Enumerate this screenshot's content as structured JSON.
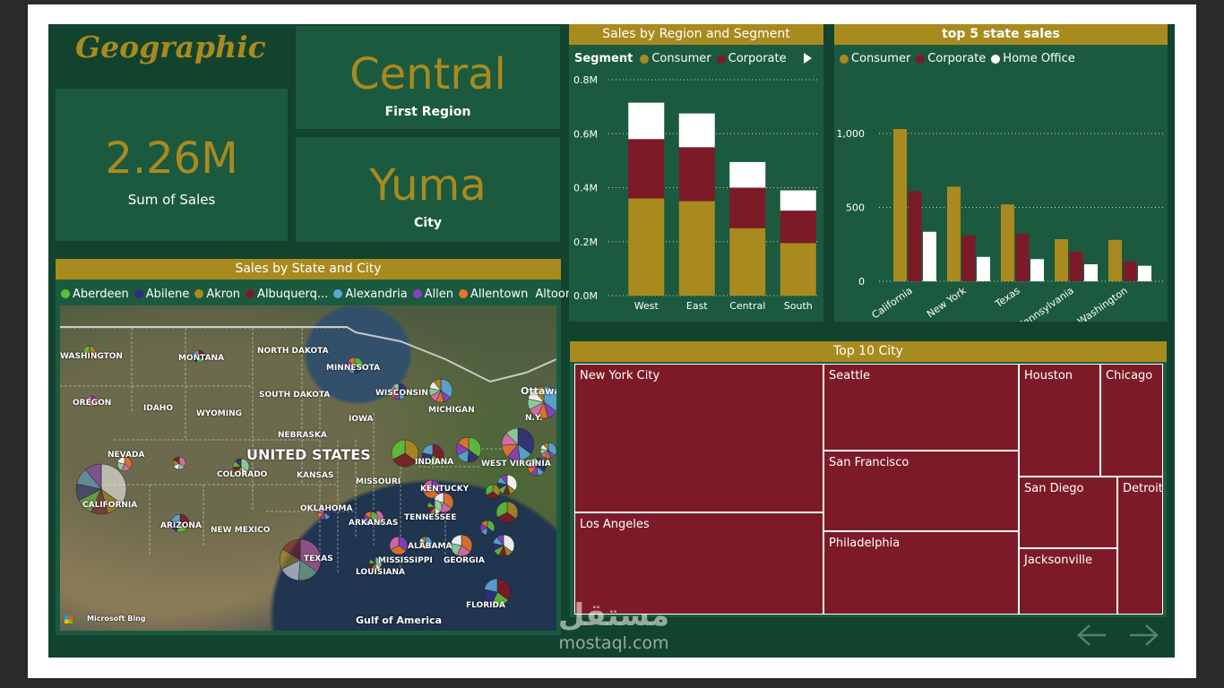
{
  "title": "Geographic",
  "kpi": {
    "first_region_value": "Central",
    "first_region_label": "First Region",
    "sales_value": "2.26M",
    "sales_label": "Sum of Sales",
    "city_value": "Yuma",
    "city_label": "City"
  },
  "colors": {
    "consumer": "#a98a1f",
    "corporate": "#7c1b27",
    "home_office": "#ffffff",
    "background": "#12432e",
    "panel": "#1b5a3f"
  },
  "map": {
    "title": "Sales by State and City",
    "legend": [
      {
        "label": "Aberdeen",
        "color": "#5fbf3a"
      },
      {
        "label": "Abilene",
        "color": "#2f2f7a"
      },
      {
        "label": "Akron",
        "color": "#a98a1f"
      },
      {
        "label": "Albuquerq...",
        "color": "#7c1b27"
      },
      {
        "label": "Alexandria",
        "color": "#5aa6d6"
      },
      {
        "label": "Allen",
        "color": "#8a3fbf"
      },
      {
        "label": "Allentown",
        "color": "#e8742a"
      },
      {
        "label": "Altoona",
        "color": ""
      }
    ],
    "labels": [
      "WASHINGTON",
      "MONTANA",
      "NORTH DAKOTA",
      "MINNESOTA",
      "SOUTH DAKOTA",
      "OREGON",
      "IDAHO",
      "WYOMING",
      "IOWA",
      "WISCONSIN",
      "MICHIGAN",
      "Ottawa",
      "N.Y.",
      "NEVADA",
      "UNITED STATES",
      "COLORADO",
      "KANSAS",
      "NEBRASKA",
      "MISSOURI",
      "INDIANA",
      "WEST VIRGINIA",
      "KENTUCKY",
      "CALIFORNIA",
      "OKLAHOMA",
      "TENNESSEE",
      "ARIZONA",
      "NEW MEXICO",
      "ARKANSAS",
      "MISSISSIPPI",
      "ALABAMA",
      "GEORGIA",
      "TEXAS",
      "LOUISIANA",
      "FLORIDA",
      "Gulf of America",
      "Microsoft Bing"
    ]
  },
  "chart_data": [
    {
      "type": "bar",
      "title": "Sales by Region and Segment",
      "legend_title": "Segment",
      "stacked": true,
      "categories": [
        "West",
        "East",
        "Central",
        "South"
      ],
      "series": [
        {
          "name": "Consumer",
          "values": [
            0.36,
            0.35,
            0.25,
            0.195
          ]
        },
        {
          "name": "Corporate",
          "values": [
            0.22,
            0.2,
            0.15,
            0.12
          ]
        },
        {
          "name": "Home Office",
          "values": [
            0.135,
            0.125,
            0.095,
            0.075
          ]
        }
      ],
      "legend_visible": [
        "Consumer",
        "Corporate"
      ],
      "yticks": [
        "0.0M",
        "0.2M",
        "0.4M",
        "0.6M",
        "0.8M"
      ],
      "ylim": [
        0,
        0.8
      ],
      "grid": true
    },
    {
      "type": "bar",
      "title": "top 5 state sales",
      "categories": [
        "California",
        "New York",
        "Texas",
        "Pennsylvania",
        "Washington"
      ],
      "series": [
        {
          "name": "Consumer",
          "values": [
            1030,
            640,
            520,
            285,
            280
          ]
        },
        {
          "name": "Corporate",
          "values": [
            610,
            310,
            320,
            200,
            135
          ]
        },
        {
          "name": "Home Office",
          "values": [
            335,
            165,
            150,
            115,
            105
          ]
        }
      ],
      "yticks": [
        "0",
        "500",
        "1,000"
      ],
      "ylim": [
        0,
        1100
      ],
      "grid": true
    },
    {
      "type": "treemap",
      "title": "Top 10 City",
      "cells": [
        "New York City",
        "Los Angeles",
        "Seattle",
        "San Francisco",
        "Philadelphia",
        "Houston",
        "Chicago",
        "San Diego",
        "Jacksonville",
        "Detroit"
      ]
    }
  ],
  "watermark": {
    "arabic": "مستقل",
    "latin": "mostaql.com"
  },
  "nav": {
    "prev_icon": "arrow-left-icon",
    "next_icon": "arrow-right-icon"
  }
}
